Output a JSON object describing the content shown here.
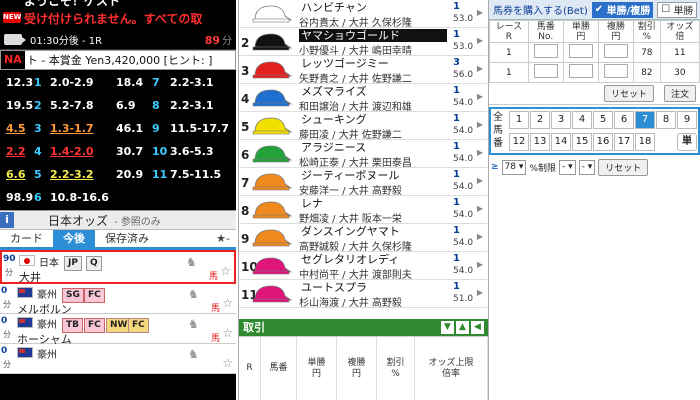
{
  "marquee": {
    "line1": "ようこそ！ゲスト",
    "line2": "受け付けられません。すべての取",
    "badge": "NEW"
  },
  "race": {
    "time": "01:30分後 - 1R",
    "minutes": "89",
    "minutes_unit": "分"
  },
  "info": {
    "tag": "NA",
    "text": "ト - 本賞金 Yen3,420,000 [ヒント: ]"
  },
  "odds_grid": [
    [
      {
        "v": "12.3",
        "c": ""
      },
      {
        "v": "1",
        "c": "num"
      },
      {
        "v": "2.0-2.9",
        "c": ""
      },
      {
        "v": "18.4",
        "c": ""
      },
      {
        "v": "7",
        "c": "num"
      },
      {
        "v": "2.2-3.1",
        "c": ""
      }
    ],
    [
      {
        "v": "19.5",
        "c": ""
      },
      {
        "v": "2",
        "c": "num"
      },
      {
        "v": "5.2-7.8",
        "c": ""
      },
      {
        "v": "6.9",
        "c": ""
      },
      {
        "v": "8",
        "c": "num"
      },
      {
        "v": "2.2-3.1",
        "c": ""
      }
    ],
    [
      {
        "v": "4.5",
        "c": "orange"
      },
      {
        "v": "3",
        "c": "num"
      },
      {
        "v": "1.3-1.7",
        "c": "orange"
      },
      {
        "v": "46.1",
        "c": ""
      },
      {
        "v": "9",
        "c": "num"
      },
      {
        "v": "11.5-17.7",
        "c": ""
      }
    ],
    [
      {
        "v": "2.2",
        "c": "red"
      },
      {
        "v": "4",
        "c": "num"
      },
      {
        "v": "1.4-2.0",
        "c": "red"
      },
      {
        "v": "30.7",
        "c": ""
      },
      {
        "v": "10",
        "c": "num"
      },
      {
        "v": "3.6-5.3",
        "c": ""
      }
    ],
    [
      {
        "v": "6.6",
        "c": "yellow"
      },
      {
        "v": "5",
        "c": "num"
      },
      {
        "v": "2.2-3.2",
        "c": "yellow"
      },
      {
        "v": "20.9",
        "c": ""
      },
      {
        "v": "11",
        "c": "num"
      },
      {
        "v": "7.5-11.5",
        "c": ""
      }
    ],
    [
      {
        "v": "98.9",
        "c": ""
      },
      {
        "v": "6",
        "c": "num"
      },
      {
        "v": "10.8-16.6",
        "c": ""
      },
      {
        "v": "",
        "c": ""
      },
      {
        "v": "",
        "c": ""
      },
      {
        "v": "",
        "c": ""
      }
    ]
  ],
  "odds_title": {
    "icon": "i",
    "title": "日本オッズ",
    "sub": "- 参照のみ"
  },
  "tabs": [
    {
      "label": "カード",
      "active": false
    },
    {
      "label": "今後",
      "active": true
    },
    {
      "label": "保存済み",
      "active": false
    }
  ],
  "tabs_star": "★-",
  "left_horses": [
    {
      "pct": "90",
      "pct_label": "分",
      "flag": "jp",
      "country": "日本",
      "name": "大井",
      "badges": [
        {
          "t": "JP",
          "s": ""
        },
        {
          "t": "Q",
          "s": ""
        }
      ],
      "uma": "馬",
      "selected": true
    },
    {
      "pct": "0",
      "pct_label": "分",
      "flag": "au",
      "country": "豪州",
      "name": "メルボルン",
      "badges": [
        {
          "t": "SG",
          "s": "pink"
        },
        {
          "t": "FC",
          "s": "pink"
        }
      ],
      "uma": "馬",
      "selected": false
    },
    {
      "pct": "0",
      "pct_label": "分",
      "flag": "au",
      "country": "豪州",
      "name": "ホーシャム",
      "badges": [
        {
          "t": "TB",
          "s": "pink"
        },
        {
          "t": "FC",
          "s": "pink"
        },
        {
          "t": "NW",
          "s": "yellow"
        },
        {
          "t": "FC",
          "s": "yellow"
        }
      ],
      "uma": "馬",
      "selected": false
    },
    {
      "pct": "0",
      "pct_label": "分",
      "flag": "au",
      "country": "豪州",
      "name": "",
      "badges": [],
      "uma": "",
      "selected": false
    }
  ],
  "entries": [
    {
      "n": "",
      "cap": "#ffffff",
      "tag": "#ffffff",
      "name": "ハンビチャン",
      "jockey": "谷内貴太 / 大井 久保杉隆",
      "num": "1",
      "weight": "53.0"
    },
    {
      "n": "2",
      "cap": "#111111",
      "tag": "#111111",
      "name": "ヤマショウゴールド",
      "jockey": "小野優斗 / 大井 嶋田幸晴",
      "num": "1",
      "weight": "53.0"
    },
    {
      "n": "3",
      "cap": "#e52020",
      "tag": "#ffffff",
      "name": "レッツゴージミー",
      "jockey": "矢野貴之 / 大井 佐野謙二",
      "num": "3",
      "weight": "56.0"
    },
    {
      "n": "4",
      "cap": "#1f6fd1",
      "tag": "#ffffff",
      "name": "メズマライズ",
      "jockey": "和田譲治 / 大井 渡辺和雄",
      "num": "1",
      "weight": "54.0"
    },
    {
      "n": "5",
      "cap": "#f2e000",
      "tag": "#ffffff",
      "name": "シューキング",
      "jockey": "藤田凌 / 大井 佐野謙二",
      "num": "1",
      "weight": "54.0"
    },
    {
      "n": "6",
      "cap": "#23a23a",
      "tag": "#ffffff",
      "name": "アラジニース",
      "jockey": "松崎正泰 / 大井 栗田泰昌",
      "num": "1",
      "weight": "54.0"
    },
    {
      "n": "7",
      "cap": "#f08a1d",
      "tag": "#ffffff",
      "name": "ジーティーボヌール",
      "jockey": "安藤洋一 / 大井 高野毅",
      "num": "1",
      "weight": "54.0"
    },
    {
      "n": "8",
      "cap": "#f08a1d",
      "tag": "#ffffff",
      "name": "レナ",
      "jockey": "野畑凌 / 大井 阪本一栄",
      "num": "1",
      "weight": "54.0"
    },
    {
      "n": "9",
      "cap": "#f08a1d",
      "tag": "#ffffff",
      "name": "ダンスイングヤマト",
      "jockey": "高野誠毅 / 大井 久保杉隆",
      "num": "1",
      "weight": "54.0"
    },
    {
      "n": "10",
      "cap": "#e0157a",
      "tag": "#ffffff",
      "name": "セグレタリオレディ",
      "jockey": "中村尚平 / 大井 渡部則夫",
      "num": "1",
      "weight": "54.0"
    },
    {
      "n": "11",
      "cap": "#e0157a",
      "tag": "#ffffff",
      "name": "ユートスプラ",
      "jockey": "杉山海渡 / 大井 高野毅",
      "num": "1",
      "weight": "51.0"
    }
  ],
  "middle_bottom": {
    "title": "取引",
    "cols": [
      "R",
      "馬番",
      "単勝\n円",
      "複勝\n円",
      "割引\n%",
      "オッズ上限\n倍率"
    ]
  },
  "bet": {
    "title": "馬券を購入する(Bet)",
    "win_place": "単勝/複勝",
    "win": "単勝",
    "cols": [
      "レース\nR",
      "馬番\nNo.",
      "単勝\n円",
      "複勝\n円",
      "割引\n%",
      "オッズ\n倍"
    ],
    "rows": [
      {
        "r": "1",
        "disc": "78",
        "odds": "11"
      },
      {
        "r": "1",
        "disc": "82",
        "odds": "30"
      }
    ],
    "reset": "リセット",
    "order": "注文"
  },
  "numpad": {
    "label": "全馬番",
    "row1": [
      "1",
      "2",
      "3",
      "4",
      "5",
      "6",
      "7",
      "8",
      "9"
    ],
    "row2": [
      "12",
      "13",
      "14",
      "15",
      "16",
      "17",
      "18"
    ],
    "active": "7",
    "side_button": "単"
  },
  "filter": {
    "symbol": "≥",
    "value": "78",
    "unit": "%制限",
    "sel1": "-",
    "sel2": "-",
    "reset": "リセット"
  }
}
